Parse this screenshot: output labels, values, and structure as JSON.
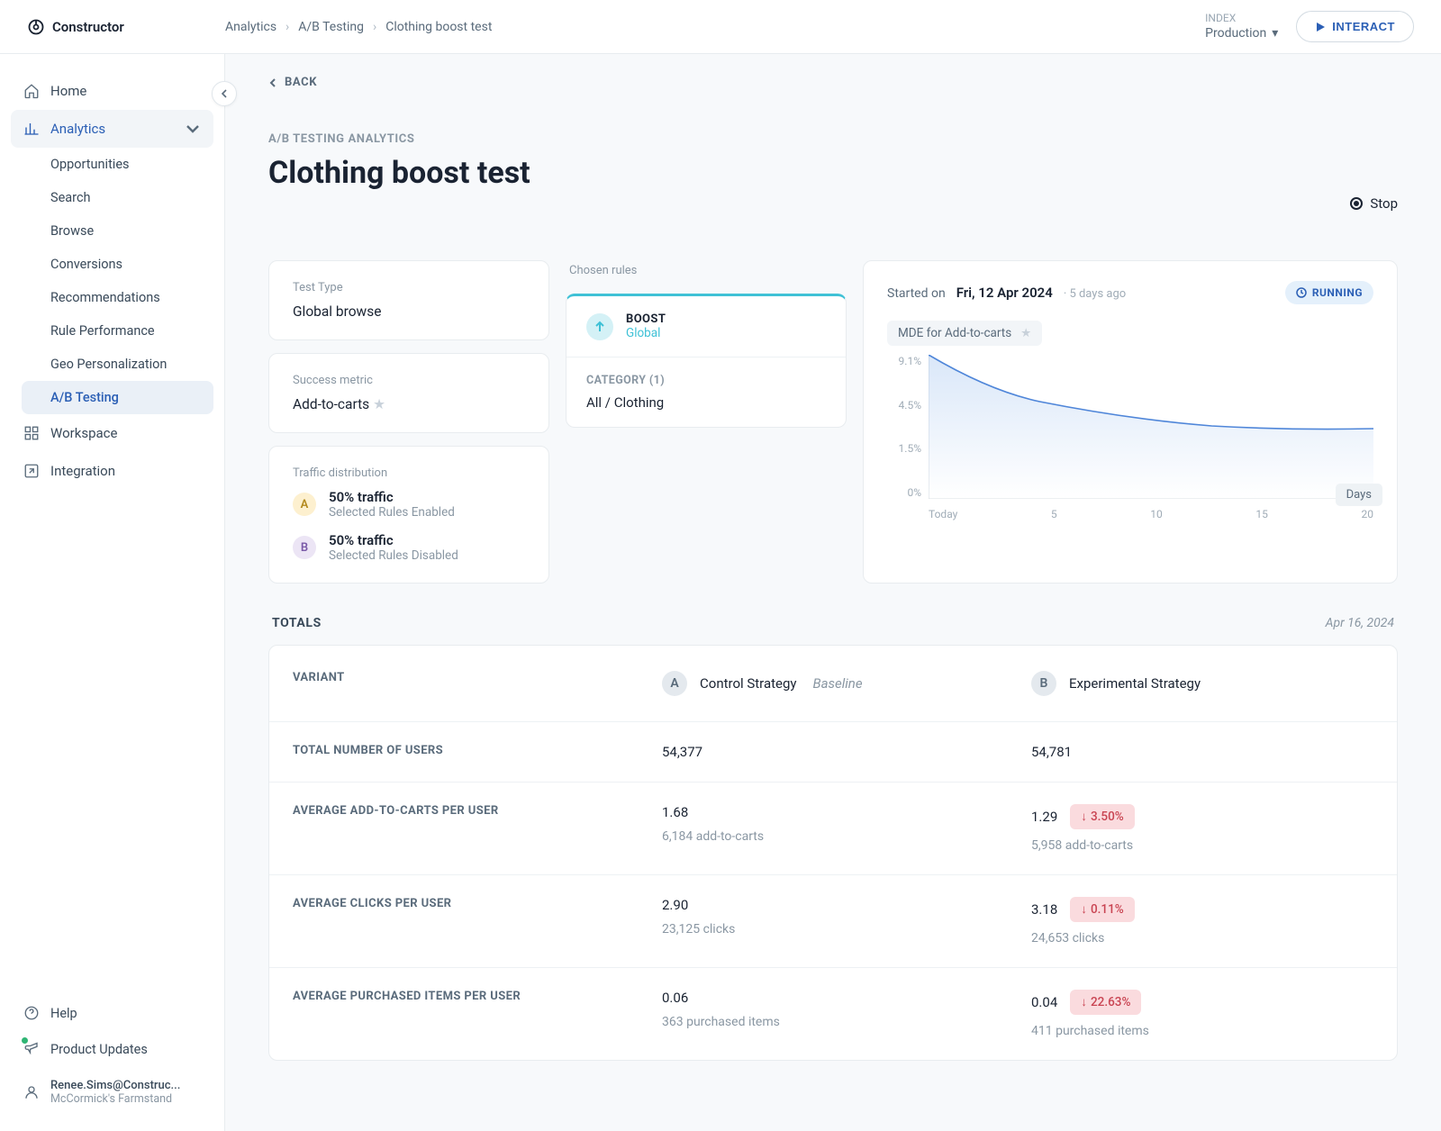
{
  "brand": "Constructor",
  "breadcrumb": [
    "Analytics",
    "A/B Testing",
    "Clothing boost test"
  ],
  "index": {
    "label": "INDEX",
    "value": "Production"
  },
  "interact_label": "INTERACT",
  "back_label": "BACK",
  "page": {
    "lede": "A/B TESTING ANALYTICS",
    "title": "Clothing boost test"
  },
  "stop_label": "Stop",
  "sidebar": {
    "items": [
      {
        "label": "Home",
        "icon": "home"
      },
      {
        "label": "Analytics",
        "icon": "chart",
        "expanded": true,
        "children": [
          "Opportunities",
          "Search",
          "Browse",
          "Conversions",
          "Recommendations",
          "Rule Performance",
          "Geo Personalization",
          "A/B Testing"
        ],
        "active_child": "A/B Testing"
      },
      {
        "label": "Workspace",
        "icon": "grid"
      },
      {
        "label": "Integration",
        "icon": "export"
      }
    ],
    "footer": [
      {
        "label": "Help",
        "icon": "help"
      },
      {
        "label": "Product Updates",
        "icon": "megaphone",
        "dot": true
      }
    ],
    "user": {
      "email": "Renee.Sims@Construc...",
      "org": "McCormick's Farmstand"
    }
  },
  "test_type": {
    "label": "Test Type",
    "value": "Global browse"
  },
  "success_metric": {
    "label": "Success metric",
    "value": "Add-to-carts"
  },
  "traffic": {
    "label": "Traffic distribution",
    "variants": [
      {
        "letter": "A",
        "pct": "50% traffic",
        "desc": "Selected Rules Enabled"
      },
      {
        "letter": "B",
        "pct": "50% traffic",
        "desc": "Selected Rules Disabled"
      }
    ]
  },
  "rules": {
    "label": "Chosen rules",
    "boost": {
      "title": "BOOST",
      "scope": "Global"
    },
    "category": {
      "label": "CATEGORY (1)",
      "value": "All / Clothing"
    }
  },
  "chart": {
    "started_label": "Started on",
    "started_date": "Fri, 12 Apr 2024",
    "ago": "· 5 days ago",
    "status": "RUNNING",
    "mde_label": "MDE for Add-to-carts",
    "days_label": "Days"
  },
  "chart_data": {
    "type": "line",
    "title": "MDE for Add-to-carts",
    "xlabel": "Days",
    "ylabel": "",
    "y_ticks": [
      "9.1%",
      "4.5%",
      "1.5%",
      "0%"
    ],
    "x_ticks": [
      "Today",
      "5",
      "10",
      "15",
      "20"
    ],
    "x": [
      0,
      5,
      10,
      15,
      20
    ],
    "values": [
      9.1,
      6.2,
      5.2,
      4.7,
      4.5
    ],
    "ylim": [
      0,
      9.1
    ]
  },
  "totals": {
    "heading": "TOTALS",
    "date": "Apr 16, 2024",
    "col_variant": "VARIANT",
    "variant_a": {
      "letter": "A",
      "name": "Control Strategy",
      "tag": "Baseline"
    },
    "variant_b": {
      "letter": "B",
      "name": "Experimental Strategy"
    },
    "rows": [
      {
        "label": "TOTAL NUMBER OF USERS",
        "a": "54,377",
        "b": "54,781"
      },
      {
        "label": "AVERAGE ADD-TO-CARTS PER USER",
        "a": "1.68",
        "a_sub": "6,184 add-to-carts",
        "b": "1.29",
        "b_sub": "5,958 add-to-carts",
        "b_delta": "3.50%"
      },
      {
        "label": "AVERAGE CLICKS PER USER",
        "a": "2.90",
        "a_sub": "23,125 clicks",
        "b": "3.18",
        "b_sub": "24,653 clicks",
        "b_delta": "0.11%"
      },
      {
        "label": "AVERAGE PURCHASED ITEMS PER USER",
        "a": "0.06",
        "a_sub": "363 purchased items",
        "b": "0.04",
        "b_sub": "411 purchased items",
        "b_delta": "22.63%"
      }
    ]
  }
}
